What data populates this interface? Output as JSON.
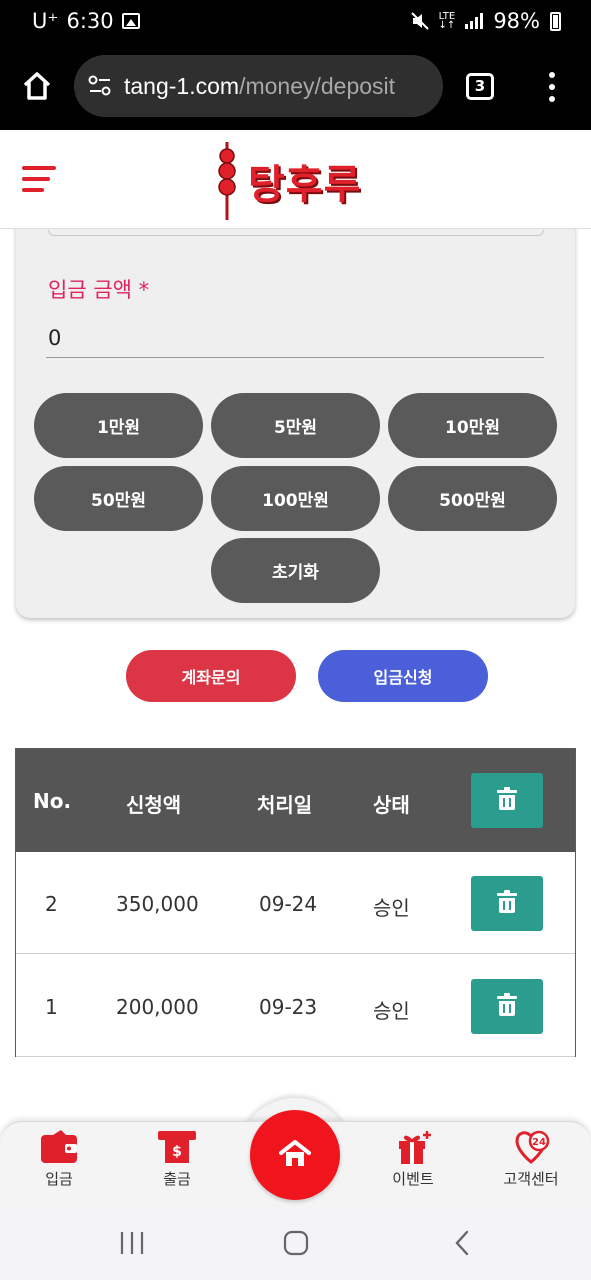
{
  "status_bar": {
    "carrier": "U⁺",
    "time": "6:30",
    "network": "LTE",
    "battery": "98%"
  },
  "browser": {
    "url_domain": "tang-1.com",
    "url_path": "/money/deposit",
    "tab_count": "3"
  },
  "header": {
    "logo_text": "탕후루"
  },
  "form": {
    "amount_label": "입금 금액 *",
    "amount_value": "0",
    "amount_buttons": [
      "1만원",
      "5만원",
      "10만원",
      "50만원",
      "100만원",
      "500만원"
    ],
    "reset_label": "초기화"
  },
  "actions": {
    "account_inquiry": "계좌문의",
    "deposit_request": "입금신청"
  },
  "table": {
    "columns": [
      "No.",
      "신청액",
      "처리일",
      "상태"
    ],
    "rows": [
      {
        "no": "2",
        "amount": "350,000",
        "date": "09-24",
        "status": "승인"
      },
      {
        "no": "1",
        "amount": "200,000",
        "date": "09-23",
        "status": "승인"
      }
    ]
  },
  "bottom_nav": {
    "deposit": "입금",
    "withdraw": "출금",
    "events": "이벤트",
    "support": "고객센터"
  },
  "colors": {
    "brand_red": "#e0202a",
    "label_pink": "#e0245e",
    "button_gray": "#5a5a5a",
    "inquiry_red": "#dc3545",
    "request_blue": "#4a5fd8",
    "teal": "#2a9d8f"
  }
}
